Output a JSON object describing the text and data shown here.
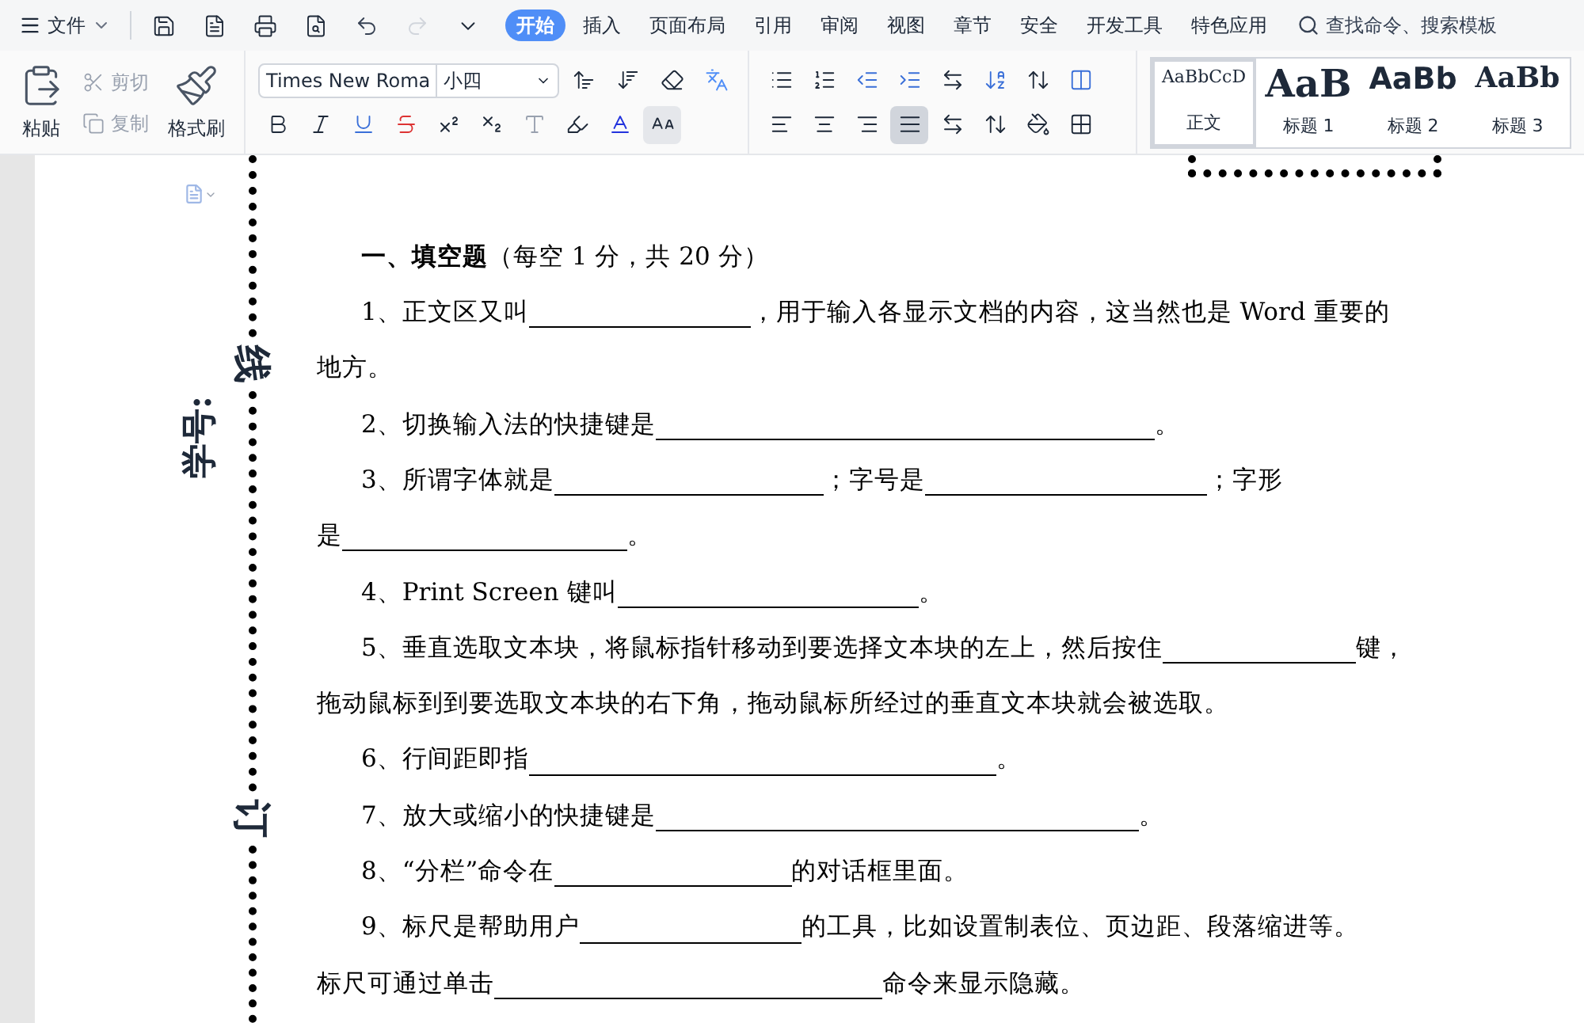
{
  "menu_bar": {
    "file_menu": "文件",
    "undo_enabled": true,
    "redo_enabled": false,
    "tabs": [
      {
        "label": "开始",
        "selected": true
      },
      {
        "label": "插入",
        "selected": false
      },
      {
        "label": "页面布局",
        "selected": false
      },
      {
        "label": "引用",
        "selected": false
      },
      {
        "label": "审阅",
        "selected": false
      },
      {
        "label": "视图",
        "selected": false
      },
      {
        "label": "章节",
        "selected": false
      },
      {
        "label": "安全",
        "selected": false
      },
      {
        "label": "开发工具",
        "selected": false
      },
      {
        "label": "特色应用",
        "selected": false
      }
    ],
    "search": {
      "placeholder": "查找命令、搜索模板"
    }
  },
  "ribbon": {
    "clipboard": [
      {
        "kind": "paste",
        "label": "粘贴",
        "disabled": false
      },
      {
        "kind": "cut",
        "label": "剪切",
        "disabled": true
      },
      {
        "kind": "copy",
        "label": "复制",
        "disabled": true
      },
      {
        "kind": "format_painter",
        "label": "格式刷",
        "disabled": false
      }
    ],
    "font_name": "Times New Roma",
    "font_size": "小四",
    "alignment": [
      {
        "selected": false
      },
      {
        "selected": false
      },
      {
        "selected": false
      },
      {
        "selected": true
      }
    ],
    "styles": [
      {
        "sample": "AaBbCcD",
        "label": "正文",
        "selected": true,
        "kind": "normal"
      },
      {
        "sample": "AaB",
        "label": "标题 1",
        "selected": false,
        "kind": "h1"
      },
      {
        "sample": "AaBb",
        "label": "标题 2",
        "selected": false,
        "kind": "h2"
      },
      {
        "sample": "AaBb",
        "label": "标题 3",
        "selected": false,
        "kind": "h3"
      }
    ]
  },
  "document": {
    "binding_labels": [
      "线",
      "订"
    ],
    "student_id_label": "学号:",
    "heading": "**一、填空题**（每空 1 分，共 20 分）",
    "questions": [
      {
        "lines": [
          [
            {
              "kind": "text",
              "text": "1、正文区又叫"
            },
            {
              "kind": "blank"
            },
            {
              "kind": "text",
              "text": "，用于输入各显示文档的内容，这当然也是 Word 重要的"
            }
          ],
          [
            {
              "kind": "text",
              "text": "地方。"
            }
          ]
        ]
      },
      {
        "lines": [
          [
            {
              "kind": "text",
              "text": "2、切换输入法的快捷键是"
            },
            {
              "kind": "blank"
            },
            {
              "kind": "text",
              "text": "。"
            }
          ]
        ]
      },
      {
        "lines": [
          [
            {
              "kind": "text",
              "text": "3、所谓字体就是"
            },
            {
              "kind": "blank"
            },
            {
              "kind": "text",
              "text": "；字号是"
            },
            {
              "kind": "blank"
            },
            {
              "kind": "text",
              "text": "；字形"
            }
          ],
          [
            {
              "kind": "text",
              "text": "是"
            },
            {
              "kind": "blank"
            },
            {
              "kind": "text",
              "text": "。"
            }
          ]
        ]
      },
      {
        "lines": [
          [
            {
              "kind": "text",
              "text": "4、Print Screen 键叫"
            },
            {
              "kind": "blank"
            },
            {
              "kind": "text",
              "text": "。"
            }
          ]
        ]
      },
      {
        "lines": [
          [
            {
              "kind": "text",
              "text": "5、垂直选取文本块，将鼠标指针移动到要选择文本块的左上，然后按住"
            },
            {
              "kind": "blank"
            },
            {
              "kind": "text",
              "text": "键，"
            }
          ],
          [
            {
              "kind": "text",
              "text": "拖动鼠标到到要选取文本块的右下角，拖动鼠标所经过的垂直文本块就会被选取。"
            }
          ]
        ]
      },
      {
        "lines": [
          [
            {
              "kind": "text",
              "text": "6、行间距即指"
            },
            {
              "kind": "blank"
            },
            {
              "kind": "text",
              "text": "。"
            }
          ]
        ]
      },
      {
        "lines": [
          [
            {
              "kind": "text",
              "text": "7、放大或缩小的快捷键是"
            },
            {
              "kind": "blank"
            },
            {
              "kind": "text",
              "text": "。"
            }
          ]
        ]
      },
      {
        "lines": [
          [
            {
              "kind": "text",
              "text": "8、“分栏”命令在"
            },
            {
              "kind": "blank"
            },
            {
              "kind": "text",
              "text": "的对话框里面。"
            }
          ]
        ]
      },
      {
        "lines": [
          [
            {
              "kind": "text",
              "text": "9、标尺是帮助用户"
            },
            {
              "kind": "blank"
            },
            {
              "kind": "text",
              "text": "的工具，比如设置制表位、页边距、段落缩进等。"
            }
          ],
          [
            {
              "kind": "text",
              "text": "标尺可通过单击"
            },
            {
              "kind": "blank"
            },
            {
              "kind": "text",
              "text": "命令来显示隐藏。"
            }
          ]
        ]
      }
    ]
  }
}
